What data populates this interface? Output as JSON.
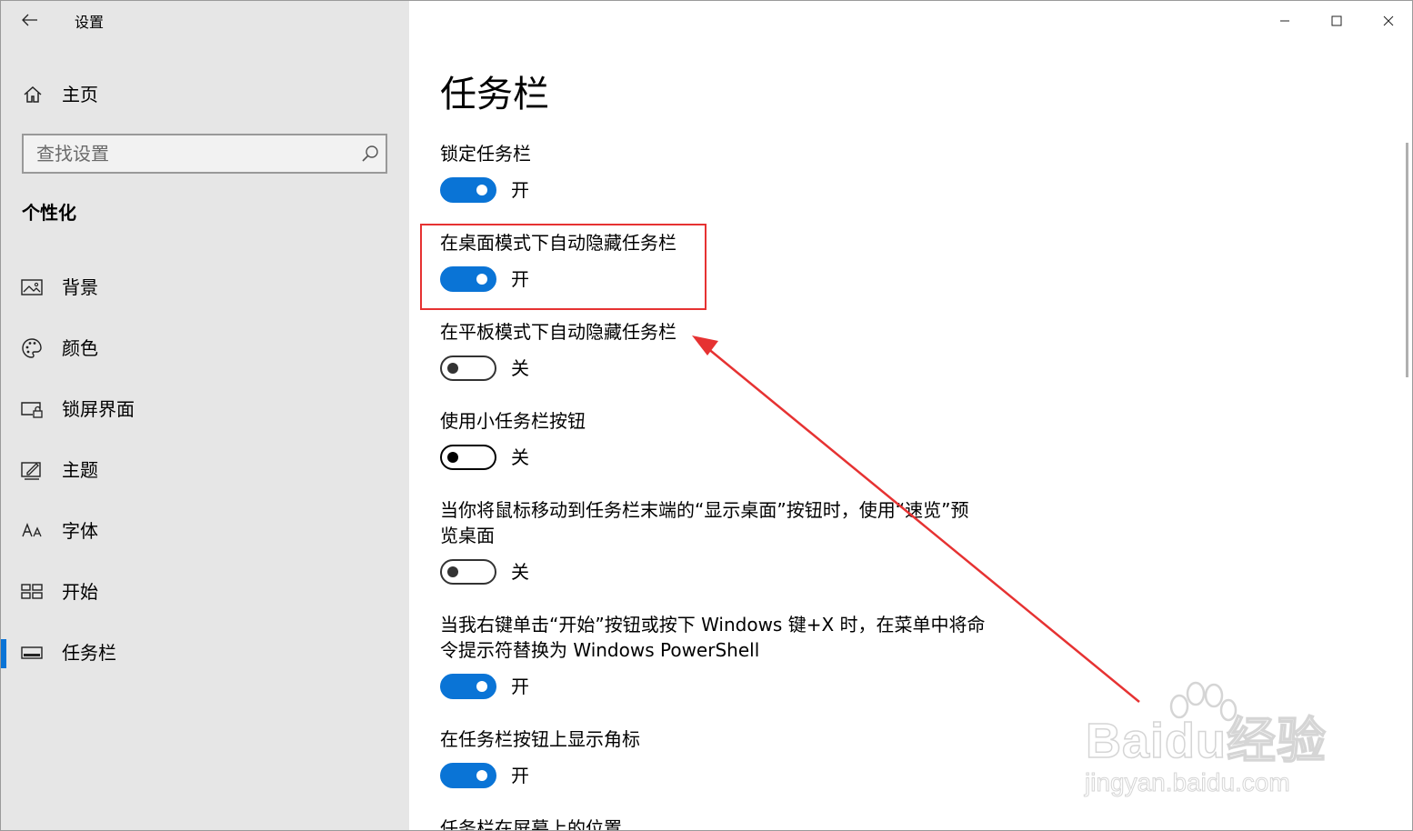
{
  "app": {
    "title": "设置"
  },
  "sidebar": {
    "home_label": "主页",
    "search_placeholder": "查找设置",
    "section_title": "个性化",
    "items": [
      {
        "label": "背景",
        "icon": "picture-icon"
      },
      {
        "label": "颜色",
        "icon": "palette-icon"
      },
      {
        "label": "锁屏界面",
        "icon": "lock-screen-icon"
      },
      {
        "label": "主题",
        "icon": "theme-icon"
      },
      {
        "label": "字体",
        "icon": "font-icon"
      },
      {
        "label": "开始",
        "icon": "start-icon"
      },
      {
        "label": "任务栏",
        "icon": "taskbar-icon",
        "active": true
      }
    ]
  },
  "main": {
    "page_title": "任务栏",
    "settings": [
      {
        "label": "锁定任务栏",
        "state": "开",
        "on": true
      },
      {
        "label": "在桌面模式下自动隐藏任务栏",
        "state": "开",
        "on": true
      },
      {
        "label": "在平板模式下自动隐藏任务栏",
        "state": "关",
        "on": false
      },
      {
        "label": "使用小任务栏按钮",
        "state": "关",
        "on": false
      },
      {
        "label_line1": "当你将鼠标移动到任务栏末端的“显示桌面”按钮时，使用“速览”预",
        "label_line2": "览桌面",
        "state": "关",
        "on": false
      },
      {
        "label_line1": "当我右键单击“开始”按钮或按下 Windows 键+X 时，在菜单中将命",
        "label_line2": "令提示符替换为 Windows PowerShell",
        "state": "开",
        "on": true
      },
      {
        "label": "在任务栏按钮上显示角标",
        "state": "开",
        "on": true
      },
      {
        "label": "任务栏在屏幕上的位置"
      }
    ]
  },
  "colors": {
    "accent": "#0a74d6",
    "annotation": "#e63232",
    "sidebar_bg": "#e6e6e6"
  },
  "watermark": {
    "brand": "Baidu经验",
    "url": "jingyan.baidu.com"
  }
}
